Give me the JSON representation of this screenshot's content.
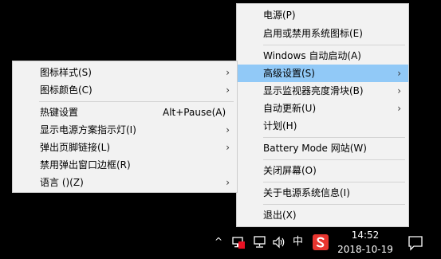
{
  "main_menu": {
    "items": [
      {
        "label": "电源(P)"
      },
      {
        "label": "启用或禁用系统图标(E)"
      },
      {
        "label": "Windows 自动启动(A)"
      },
      {
        "label": "高级设置(S)",
        "arrow": "›"
      },
      {
        "label": "显示监视器亮度滑块(B)",
        "arrow": "›"
      },
      {
        "label": "自动更新(U)",
        "arrow": "›"
      },
      {
        "label": "计划(H)"
      },
      {
        "label": "Battery Mode 网站(W)"
      },
      {
        "label": "关闭屏幕(O)"
      },
      {
        "label": "关于电源系统信息(I)"
      },
      {
        "label": "退出(X)"
      }
    ]
  },
  "sub_menu": {
    "items": [
      {
        "label": "图标样式(S)",
        "arrow": "›"
      },
      {
        "label": "图标颜色(C)",
        "arrow": "›"
      },
      {
        "label": "热键设置",
        "shortcut": "Alt+Pause(A)"
      },
      {
        "label": "显示电源方案指示灯(I)",
        "arrow": "›"
      },
      {
        "label": "弹出页脚链接(L)",
        "arrow": "›"
      },
      {
        "label": "禁用弹出窗口边框(R)"
      },
      {
        "label": "语言 ()(Z)",
        "arrow": "›"
      }
    ]
  },
  "taskbar": {
    "chevron": "^",
    "ime": "中",
    "clock_time": "14:52",
    "clock_date": "2018-10-19",
    "colors": {
      "highlight": "#91c9f7",
      "sogou": "#e8352f",
      "power_red": "#e81123"
    }
  }
}
